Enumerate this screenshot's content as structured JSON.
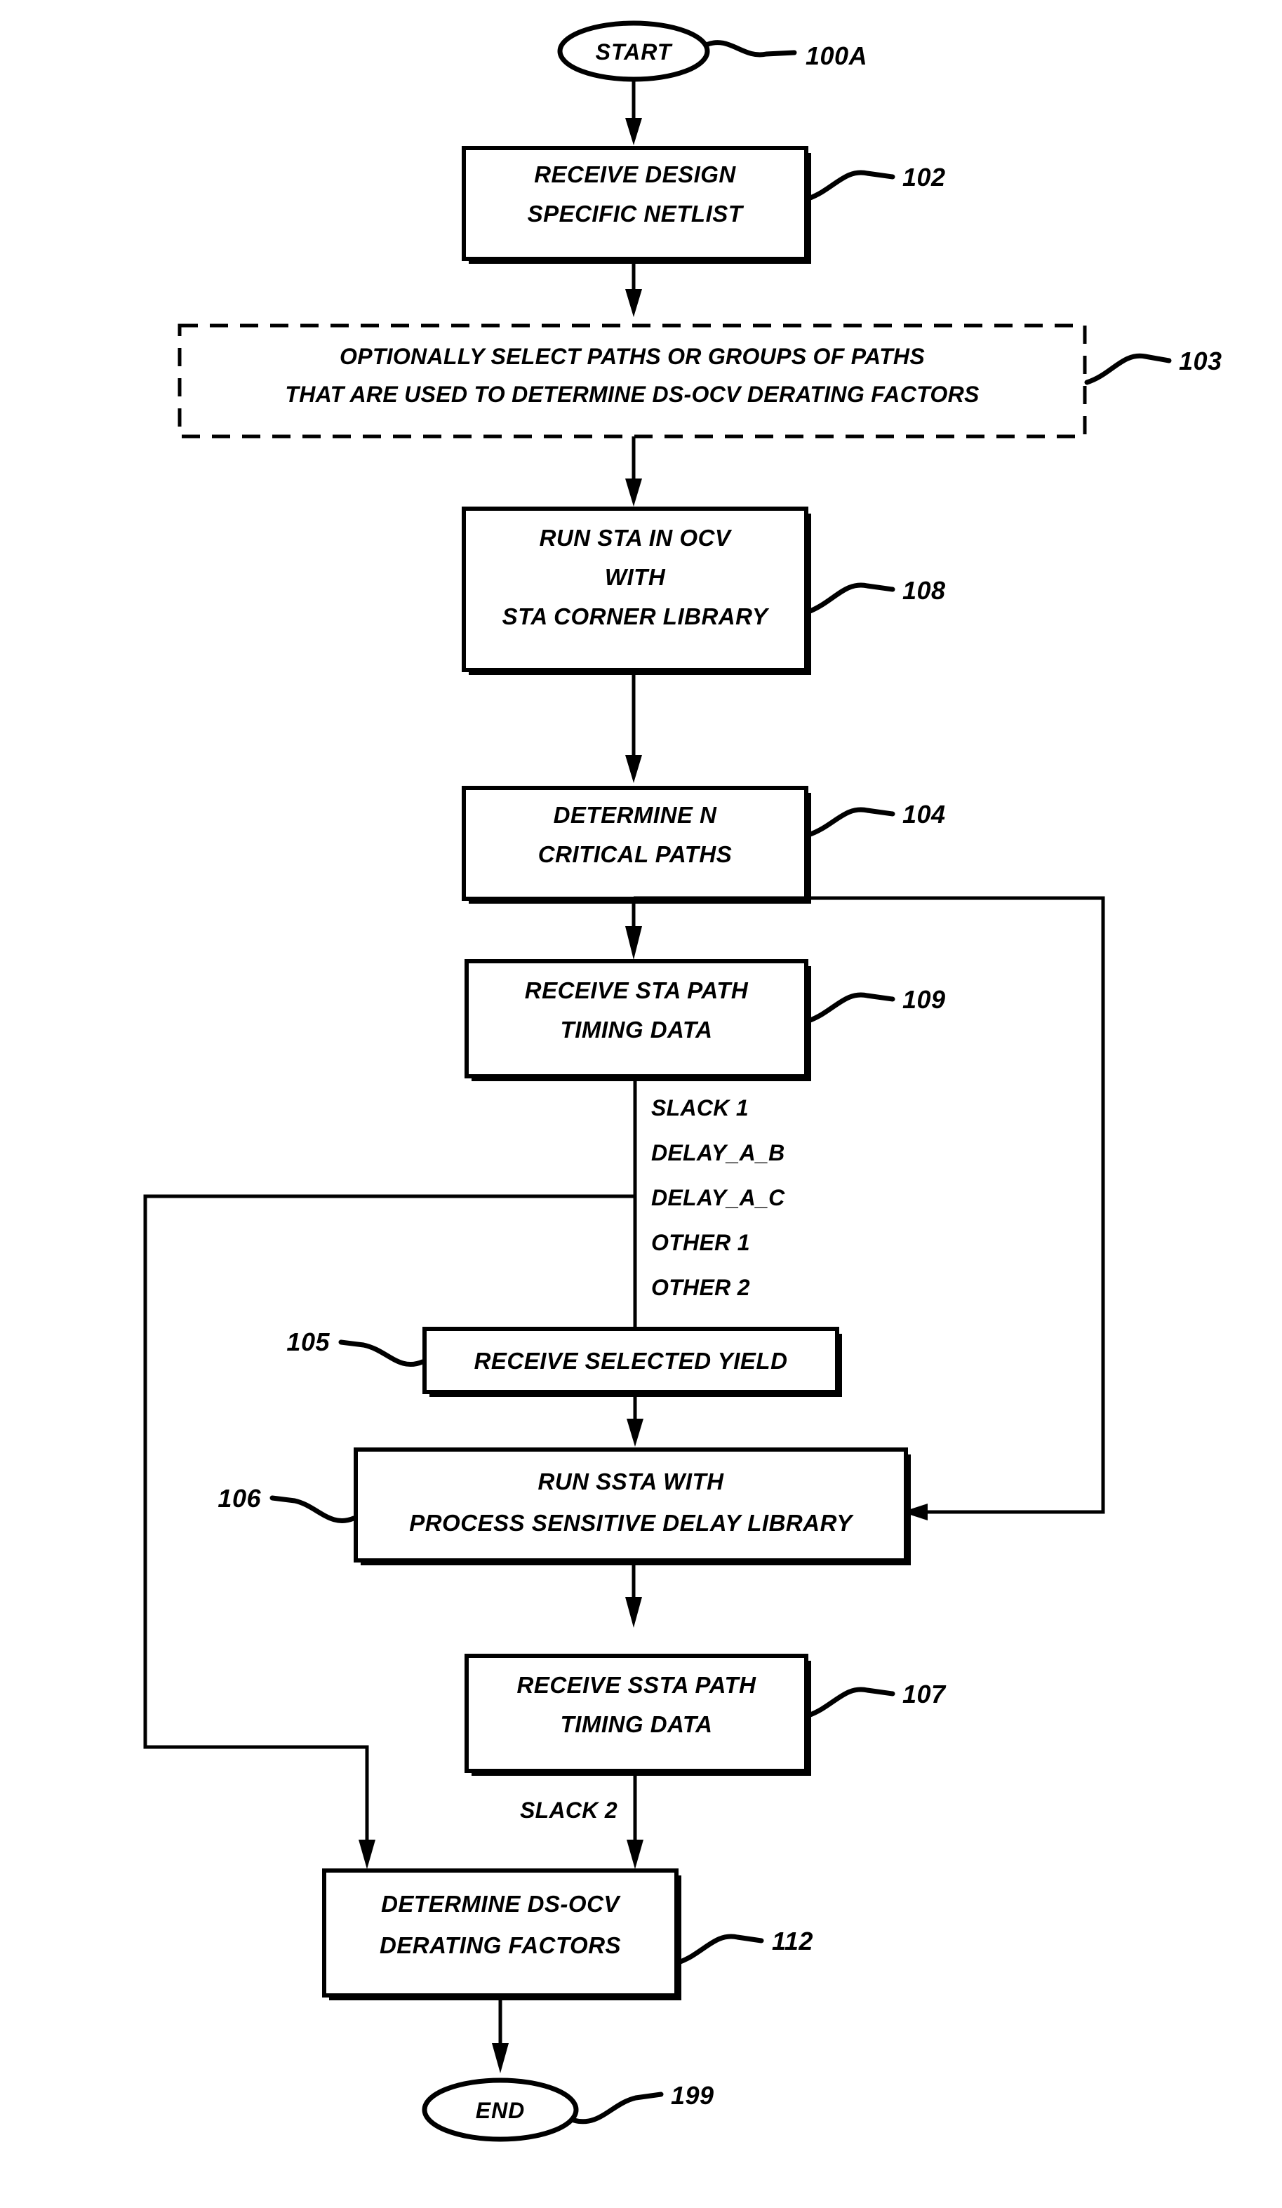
{
  "diagram": {
    "title_present": false,
    "colors": {
      "line": "#000000",
      "fill": "#ffffff"
    },
    "nodes": {
      "start": {
        "label": "START",
        "ref": "100A"
      },
      "n102": {
        "line1": "RECEIVE DESIGN",
        "line2": "SPECIFIC NETLIST",
        "ref": "102"
      },
      "n103": {
        "line1": "OPTIONALLY SELECT PATHS OR GROUPS OF PATHS",
        "line2": "THAT ARE USED TO DETERMINE DS-OCV DERATING FACTORS",
        "ref": "103"
      },
      "n108": {
        "line1": "RUN STA IN OCV",
        "line2": "WITH",
        "line3": "STA CORNER LIBRARY",
        "ref": "108"
      },
      "n104": {
        "line1": "DETERMINE N",
        "line2": "CRITICAL PATHS",
        "ref": "104"
      },
      "n109": {
        "line1": "RECEIVE STA PATH",
        "line2": "TIMING DATA",
        "ref": "109"
      },
      "n105": {
        "line1": "RECEIVE SELECTED YIELD",
        "ref": "105"
      },
      "n106": {
        "line1": "RUN SSTA WITH",
        "line2": "PROCESS  SENSITIVE DELAY LIBRARY",
        "ref": "106"
      },
      "n107": {
        "line1": "RECEIVE SSTA PATH",
        "line2": "TIMING DATA",
        "ref": "107"
      },
      "n112": {
        "line1": "DETERMINE DS-OCV",
        "line2": "DERATING FACTORS",
        "ref": "112"
      },
      "end": {
        "label": "END",
        "ref": "199"
      }
    },
    "edge_labels": {
      "sta_outputs": [
        "SLACK 1",
        "DELAY_A_B",
        "DELAY_A_C",
        "OTHER 1",
        "OTHER 2"
      ],
      "ssta_output": "SLACK 2"
    }
  }
}
